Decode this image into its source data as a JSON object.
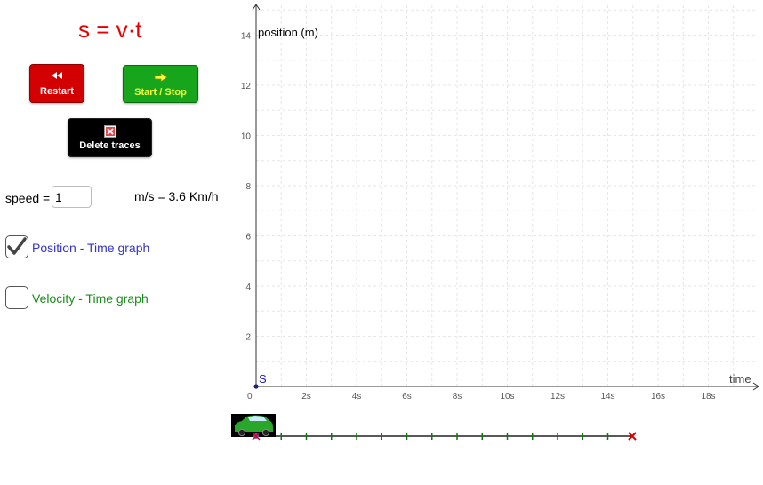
{
  "formula": "s = v·t",
  "buttons": {
    "restart": "Restart",
    "start_stop": "Start / Stop",
    "delete_traces": "Delete traces"
  },
  "speed": {
    "label": "speed =",
    "value": "1",
    "unit_text": "m/s = 3.6 Km/h"
  },
  "checkboxes": {
    "position_time": {
      "label": "Position - Time graph",
      "checked": true
    },
    "velocity_time": {
      "label": "Velocity - Time graph",
      "checked": false
    }
  },
  "graph": {
    "y_axis_label": "position (m)",
    "x_axis_label": "time",
    "origin_label": "0",
    "point_label": "S",
    "y_ticks": [
      "2",
      "4",
      "6",
      "8",
      "10",
      "12",
      "14"
    ],
    "x_ticks": [
      "2s",
      "4s",
      "6s",
      "8s",
      "10s",
      "12s",
      "14s",
      "16s",
      "18s"
    ]
  },
  "track": {
    "tick_count": 15,
    "car_position": 0,
    "end_marker_position": 15
  },
  "colors": {
    "formula": "#e60000",
    "restart": "#d20000",
    "start_stop": "#17a51b",
    "delete": "#000000",
    "position_label": "#3333cc",
    "velocity_label": "#1a8c1a",
    "grid": "#e6e6e6",
    "track_ticks": "#0a7a0a",
    "end_marker": "#e00000",
    "point_s": "#1e1ed0"
  }
}
